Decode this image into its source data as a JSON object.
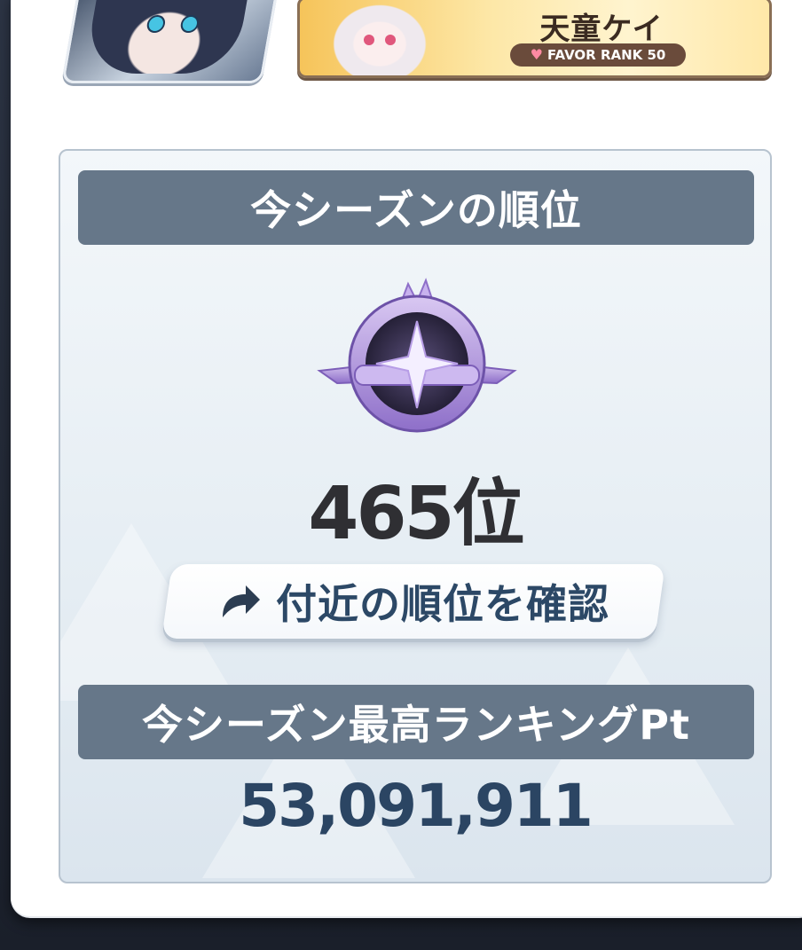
{
  "character": {
    "name": "天童ケイ",
    "favor_rank": "FAVOR RANK 50",
    "favor_icon": "heart-icon"
  },
  "season_rank": {
    "header": "今シーズンの順位",
    "rank": "465位",
    "emblem_icon": "rank-emblem-icon",
    "nearby_button": "付近の順位を確認",
    "nearby_icon": "share-arrow-icon"
  },
  "season_points": {
    "header": "今シーズン最高ランキングPt",
    "value": "53,091,911"
  },
  "colors": {
    "header_bg": "#667789",
    "rank_text": "#2f2f33",
    "points_text": "#2b4563",
    "emblem_purple": "#a88ad8"
  }
}
